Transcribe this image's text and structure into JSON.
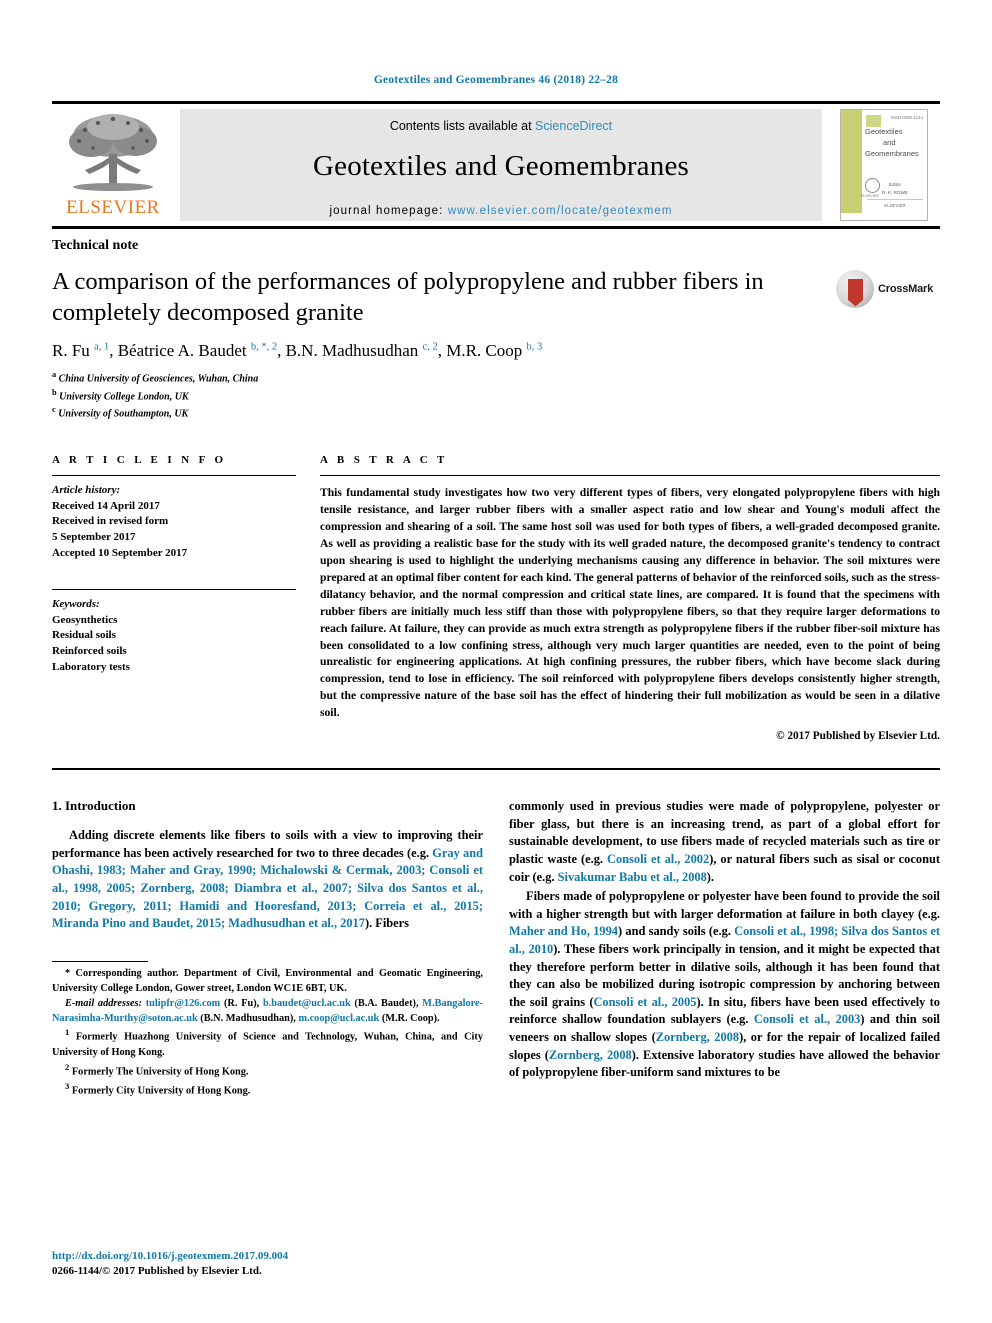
{
  "running_head": "Geotextiles and Geomembranes 46 (2018) 22–28",
  "masthead": {
    "contents_prefix": "Contents lists available at ",
    "sciencedirect": "ScienceDirect",
    "journal_title": "Geotextiles and Geomembranes",
    "homepage_label": "journal homepage:",
    "homepage_url": "www.elsevier.com/locate/geotexmem",
    "publisher_wordmark": "ELSEVIER",
    "accent_link_color": "#2e8bc4",
    "publisher_color": "#e87722",
    "cover": {
      "title_line1": "Geotextiles",
      "title_line2": "and",
      "title_line3": "Geomembranes",
      "issn": "ISSN 0266-1144",
      "editor_label": "Editor",
      "editor_name": "R. K. ROWE",
      "footer": "ELSEVIER",
      "stripe_color": "#c6cf72"
    }
  },
  "article": {
    "type": "Technical note",
    "title": "A comparison of the performances of polypropylene and rubber fibers in completely decomposed granite",
    "crossmark_label": "CrossMark",
    "authors_html": "R. Fu <sup>a, 1</sup>, Béatrice A. Baudet <sup>b, *, 2</sup>, B.N. Madhusudhan <sup>c, 2</sup>, M.R. Coop <sup>b, 3</sup>",
    "affiliations": [
      {
        "mark": "a",
        "text": "China University of Geosciences, Wuhan, China"
      },
      {
        "mark": "b",
        "text": "University College London, UK"
      },
      {
        "mark": "c",
        "text": "University of Southampton, UK"
      }
    ]
  },
  "info": {
    "heading": "A R T I C L E   I N F O",
    "history_label": "Article history:",
    "history": [
      "Received 14 April 2017",
      "Received in revised form",
      "5 September 2017",
      "Accepted 10 September 2017"
    ],
    "keywords_label": "Keywords:",
    "keywords": [
      "Geosynthetics",
      "Residual soils",
      "Reinforced soils",
      "Laboratory tests"
    ]
  },
  "abstract": {
    "heading": "A B S T R A C T",
    "text": "This fundamental study investigates how two very different types of fibers, very elongated polypropylene fibers with high tensile resistance, and larger rubber fibers with a smaller aspect ratio and low shear and Young's moduli affect the compression and shearing of a soil. The same host soil was used for both types of fibers, a well-graded decomposed granite. As well as providing a realistic base for the study with its well graded nature, the decomposed granite's tendency to contract upon shearing is used to highlight the underlying mechanisms causing any difference in behavior. The soil mixtures were prepared at an optimal fiber content for each kind. The general patterns of behavior of the reinforced soils, such as the stress-dilatancy behavior, and the normal compression and critical state lines, are compared. It is found that the specimens with rubber fibers are initially much less stiff than those with polypropylene fibers, so that they require larger deformations to reach failure. At failure, they can provide as much extra strength as polypropylene fibers if the rubber fiber-soil mixture has been consolidated to a low confining stress, although very much larger quantities are needed, even to the point of being unrealistic for engineering applications. At high confining pressures, the rubber fibers, which have become slack during compression, tend to lose in efficiency. The soil reinforced with polypropylene fibers develops consistently higher strength, but the compressive nature of the base soil has the effect of hindering their full mobilization as would be seen in a dilative soil.",
    "copyright": "© 2017 Published by Elsevier Ltd."
  },
  "introduction": {
    "heading": "1. Introduction",
    "left_para_html": "Adding discrete elements like fibers to soils with a view to improving their performance has been actively researched for two to three decades (e.g. <span class=\"ref\">Gray and Ohashi, 1983; Maher and Gray, 1990; Michalowski &amp; Cermak, 2003; Consoli et al., 1998, 2005; Zornberg, 2008; Diambra et al., 2007; Silva dos Santos et al., 2010; Gregory, 2011; Hamidi and Hooresfand, 2013; Correia et al., 2015; Miranda Pino and Baudet, 2015; Madhusudhan et al., 2017</span>). Fibers",
    "right_para1_html": "commonly used in previous studies were made of polypropylene, polyester or fiber glass, but there is an increasing trend, as part of a global effort for sustainable development, to use fibers made of recycled materials such as tire or plastic waste (e.g. <span class=\"ref\">Consoli et al., 2002</span>), or natural fibers such as sisal or coconut coir (e.g. <span class=\"ref\">Sivakumar Babu et al., 2008</span>).",
    "right_para2_html": "Fibers made of polypropylene or polyester have been found to provide the soil with a higher strength but with larger deformation at failure in both clayey (e.g. <span class=\"ref\">Maher and Ho, 1994</span>) and sandy soils (e.g. <span class=\"ref\">Consoli et al., 1998; Silva dos Santos et al., 2010</span>). These fibers work principally in tension, and it might be expected that they therefore perform better in dilative soils, although it has been found that they can also be mobilized during isotropic compression by anchoring between the soil grains (<span class=\"ref\">Consoli et al., 2005</span>). In situ, fibers have been used effectively to reinforce shallow foundation sublayers (e.g. <span class=\"ref\">Consoli et al., 2003</span>) and thin soil veneers on shallow slopes (<span class=\"ref\">Zornberg, 2008</span>), or for the repair of localized failed slopes (<span class=\"ref\">Zornberg, 2008</span>). Extensive laboratory studies have allowed the behavior of polypropylene fiber-uniform sand mixtures to be"
  },
  "footnotes": {
    "corresponding_html": "* Corresponding author. Department of Civil, Environmental and Geomatic Engineering, University College London, Gower street, London WC1E 6BT, UK.",
    "emails_html": "<i>E-mail addresses:</i> <span class=\"ref\">tulipfr@126.com</span> (R. Fu), <span class=\"ref\">b.baudet@ucl.ac.uk</span> (B.A. Baudet), <span class=\"ref\">M.Bangalore-Narasimha-Murthy@soton.ac.uk</span> (B.N. Madhusudhan), <span class=\"ref\">m.coop@ucl.ac.uk</span> (M.R. Coop).",
    "notes": [
      {
        "mark": "1",
        "text": "Formerly Huazhong University of Science and Technology, Wuhan, China, and City University of Hong Kong."
      },
      {
        "mark": "2",
        "text": "Formerly The University of Hong Kong."
      },
      {
        "mark": "3",
        "text": "Formerly City University of Hong Kong."
      }
    ]
  },
  "footer": {
    "doi": "http://dx.doi.org/10.1016/j.geotexmem.2017.09.004",
    "issn_line": "0266-1144/© 2017 Published by Elsevier Ltd."
  }
}
